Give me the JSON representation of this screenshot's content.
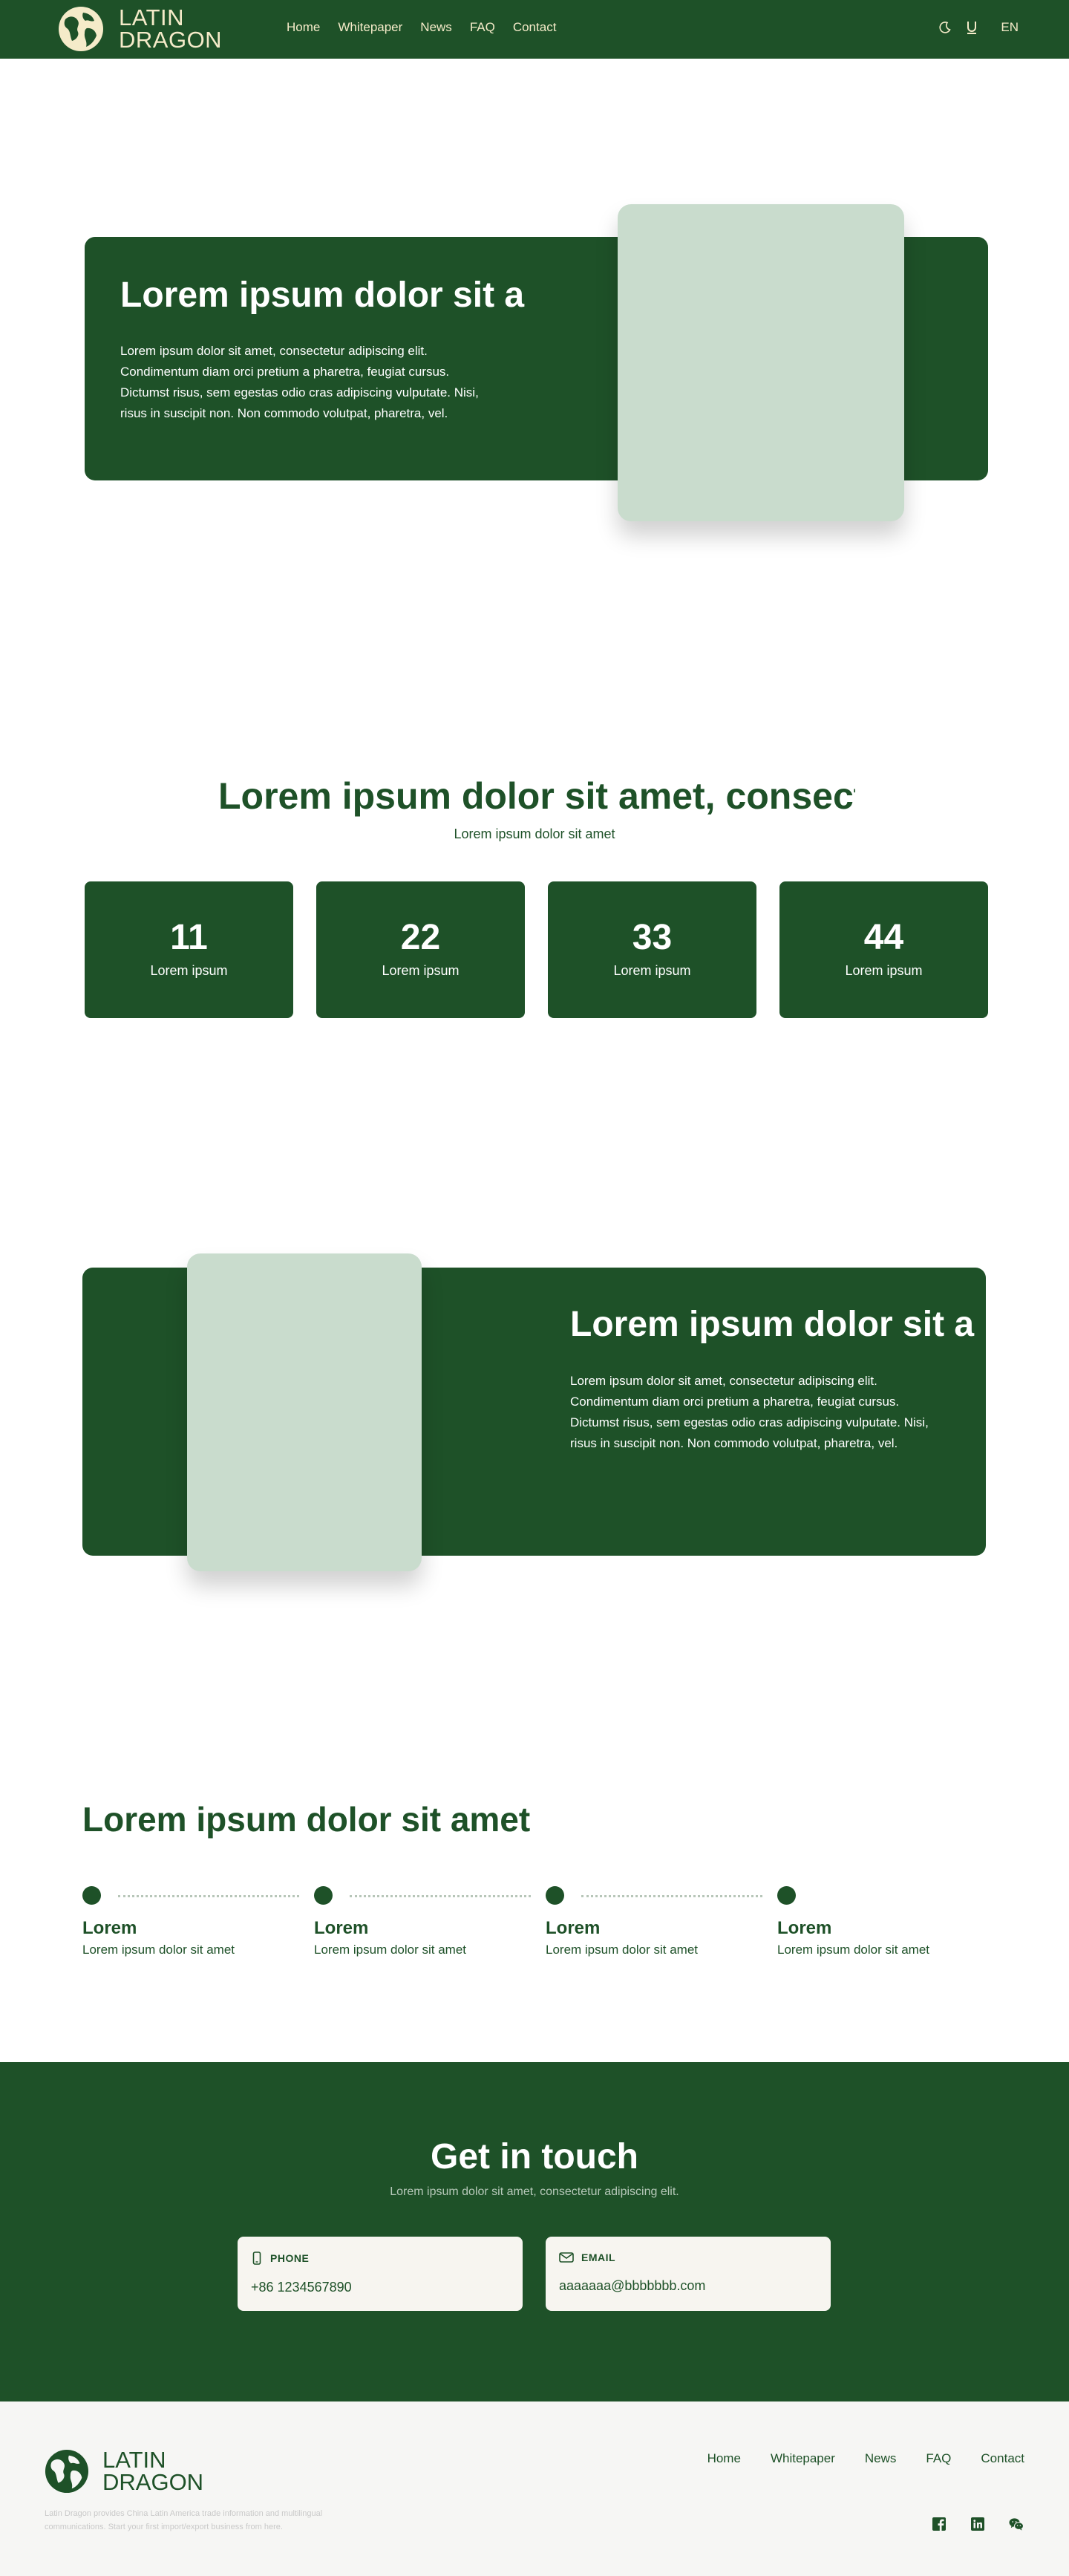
{
  "brand": {
    "line1": "LATIN",
    "line2": "DRAGON"
  },
  "nav": {
    "links": [
      "Home",
      "Whitepaper",
      "News",
      "FAQ",
      "Contact"
    ],
    "theme_icon": "moon-icon",
    "user_icon": "underline-u-icon",
    "language": "EN"
  },
  "hero": {
    "title": "Lorem ipsum dolor sit amet",
    "text": "Lorem ipsum dolor sit amet, consectetur adipiscing elit. Condimentum diam orci pretium a pharetra, feugiat cursus. Dictumst risus, sem egestas odio cras adipiscing vulputate. Nisi, risus in suscipit non. Non commodo volutpat, pharetra, vel."
  },
  "stats": {
    "title": "Lorem ipsum dolor sit amet, consectetur",
    "subtitle": "Lorem ipsum dolor sit amet",
    "items": [
      {
        "value": "11",
        "label": "Lorem ipsum"
      },
      {
        "value": "22",
        "label": "Lorem ipsum"
      },
      {
        "value": "33",
        "label": "Lorem ipsum"
      },
      {
        "value": "44",
        "label": "Lorem ipsum"
      }
    ]
  },
  "feature2": {
    "title": "Lorem ipsum dolor sit amet",
    "text": "Lorem ipsum dolor sit amet, consectetur adipiscing elit. Condimentum diam orci pretium a pharetra, feugiat cursus. Dictumst risus, sem egestas odio cras adipiscing vulputate. Nisi, risus in suscipit non. Non commodo volutpat, pharetra, vel."
  },
  "steps": {
    "title": "Lorem ipsum dolor sit amet",
    "items": [
      {
        "name": "Lorem",
        "desc": "Lorem ipsum dolor sit amet"
      },
      {
        "name": "Lorem",
        "desc": "Lorem ipsum dolor sit amet"
      },
      {
        "name": "Lorem",
        "desc": "Lorem ipsum dolor sit amet"
      },
      {
        "name": "Lorem",
        "desc": "Lorem ipsum dolor sit amet"
      }
    ]
  },
  "contact": {
    "title": "Get in touch",
    "subtitle": "Lorem ipsum dolor sit amet, consectetur adipiscing elit.",
    "phone_label": "PHONE",
    "phone": "+86 1234567890",
    "email_label": "EMAIL",
    "email": "aaaaaaa@bbbbbbb.com"
  },
  "footer": {
    "description": "Latin Dragon provides China Latin America trade information and multilingual communications. Start your first import/export business from here.",
    "links": [
      "Home",
      "Whitepaper",
      "News",
      "FAQ",
      "Contact"
    ],
    "social": [
      "facebook-icon",
      "linkedin-icon",
      "wechat-icon"
    ]
  },
  "colors": {
    "primary": "#1e5128",
    "mint": "#c9dccd",
    "cream": "#f5ebc9",
    "white": "#ffffff"
  }
}
